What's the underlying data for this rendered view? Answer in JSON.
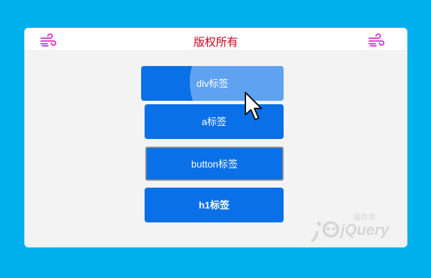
{
  "header": {
    "title": "版权所有",
    "left_icon": "wind-icon",
    "right_icon": "wind-icon",
    "title_color": "#d0021b",
    "icon_color": "#e026c8"
  },
  "buttons": [
    {
      "label": "div标签",
      "tag": "div"
    },
    {
      "label": "a标签",
      "tag": "a"
    },
    {
      "label": "button标签",
      "tag": "button"
    },
    {
      "label": "h1标签",
      "tag": "h1"
    }
  ],
  "watermark": {
    "logo_text": "jQuery",
    "cn_text": "插件库",
    "icon": "jquery-logo-watermark"
  },
  "colors": {
    "background": "#00b0ec",
    "button": "#0a70e8",
    "card": "#f3f3f3"
  },
  "cursor": "pointer-cursor-icon"
}
